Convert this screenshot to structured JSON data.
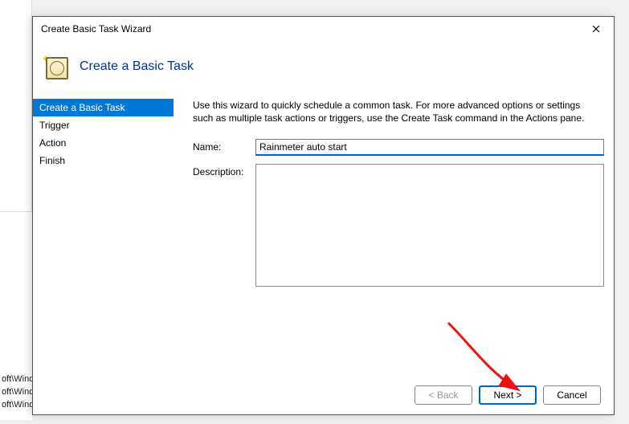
{
  "dialog": {
    "title": "Create Basic Task Wizard",
    "header": "Create a Basic Task",
    "intro": "Use this wizard to quickly schedule a common task.  For more advanced options or settings such as multiple task actions or triggers, use the Create Task command in the Actions pane.",
    "sidebar": {
      "items": [
        "Create a Basic Task",
        "Trigger",
        "Action",
        "Finish"
      ],
      "selected_index": 0
    },
    "fields": {
      "name_label": "Name:",
      "name_value": "Rainmeter auto start",
      "desc_label": "Description:",
      "desc_value": ""
    },
    "buttons": {
      "back": "< Back",
      "next": "Next >",
      "cancel": "Cancel"
    }
  },
  "background": {
    "line1": "oft\\Wind",
    "line2": "oft\\Windows\\U…",
    "line3": "oft\\Windows\\ Fli"
  }
}
